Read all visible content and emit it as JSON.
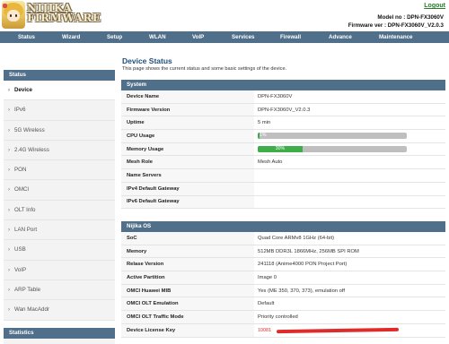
{
  "header": {
    "logo_line1": "NIJIKA",
    "logo_line2": "FIRMWARE",
    "logout_label": "Logout",
    "model_line": "Model no : DPN-FX3060V",
    "firmware_line": "Firmware ver : DPN-FX3060V_V2.0.3"
  },
  "topnav": [
    {
      "label": "Status"
    },
    {
      "label": "Wizard"
    },
    {
      "label": "Setup"
    },
    {
      "label": "WLAN"
    },
    {
      "label": "VoIP"
    },
    {
      "label": "Services"
    },
    {
      "label": "Firewall"
    },
    {
      "label": "Advance"
    },
    {
      "label": "Maintenance"
    }
  ],
  "sidebar": {
    "header": "Status",
    "items": [
      {
        "label": "Device"
      },
      {
        "label": "IPv6"
      },
      {
        "label": "5G Wireless"
      },
      {
        "label": "2.4G Wireless"
      },
      {
        "label": "PON"
      },
      {
        "label": "OMCI"
      },
      {
        "label": "OLT Info"
      },
      {
        "label": "LAN Port"
      },
      {
        "label": "USB"
      },
      {
        "label": "VoIP"
      },
      {
        "label": "ARP Table"
      },
      {
        "label": "Wan MacAddr"
      }
    ],
    "active_index": 0,
    "statistics_header": "Statistics"
  },
  "page": {
    "title": "Device Status",
    "description": "This page shows the current status and some basic settings of the device."
  },
  "system": {
    "title": "System",
    "rows": {
      "device_name": {
        "k": "Device Name",
        "v": "DPN-FX3060V"
      },
      "firmware_version": {
        "k": "Firmware Version",
        "v": "DPN-FX3060V_V2.0.3"
      },
      "uptime": {
        "k": "Uptime",
        "v": "5 min"
      },
      "cpu_usage": {
        "k": "CPU Usage",
        "v": "1%",
        "percent": 1
      },
      "memory_usage": {
        "k": "Memory Usage",
        "v": "30%",
        "percent": 30
      },
      "mesh_role": {
        "k": "Mesh Role",
        "v": "Mesh Auto"
      },
      "name_servers": {
        "k": "Name Servers",
        "v": ""
      },
      "ipv4_gateway": {
        "k": "IPv4 Default Gateway",
        "v": ""
      },
      "ipv6_gateway": {
        "k": "IPv6 Default Gateway",
        "v": ""
      }
    }
  },
  "nijika_os": {
    "title": "Nijika OS",
    "rows": {
      "soc": {
        "k": "SoC",
        "v": "Quad Core ARMv8 1GHz (64-bit)"
      },
      "memory": {
        "k": "Memory",
        "v": "512MB DDR3L 1866MHz, 256MB SPI ROM"
      },
      "release_version": {
        "k": "Relase Version",
        "v": "241118 (Anime4000 PON Project Port)"
      },
      "active_partition": {
        "k": "Active Partition",
        "v": "Image 0"
      },
      "omci_huawei_mib": {
        "k": "OMCI Huawei MIB",
        "v": "Yes (ME 350, 370, 373), emulation off"
      },
      "omci_olt_emulation": {
        "k": "OMCI OLT Emulation",
        "v": "Default"
      },
      "omci_olt_traffic_mode": {
        "k": "OMCI OLT Traffic Mode",
        "v": "Priority controlled"
      },
      "device_license_key": {
        "k": "Device License Key",
        "v": "10081"
      }
    }
  },
  "colors": {
    "nav_bg": "#4f6f8a",
    "title_blue": "#1e4e7a",
    "progress_green": "#3fae49",
    "progress_track": "#bfbfbf",
    "logout_green": "#2a7a2a",
    "redaction_red": "#e02b2b"
  }
}
